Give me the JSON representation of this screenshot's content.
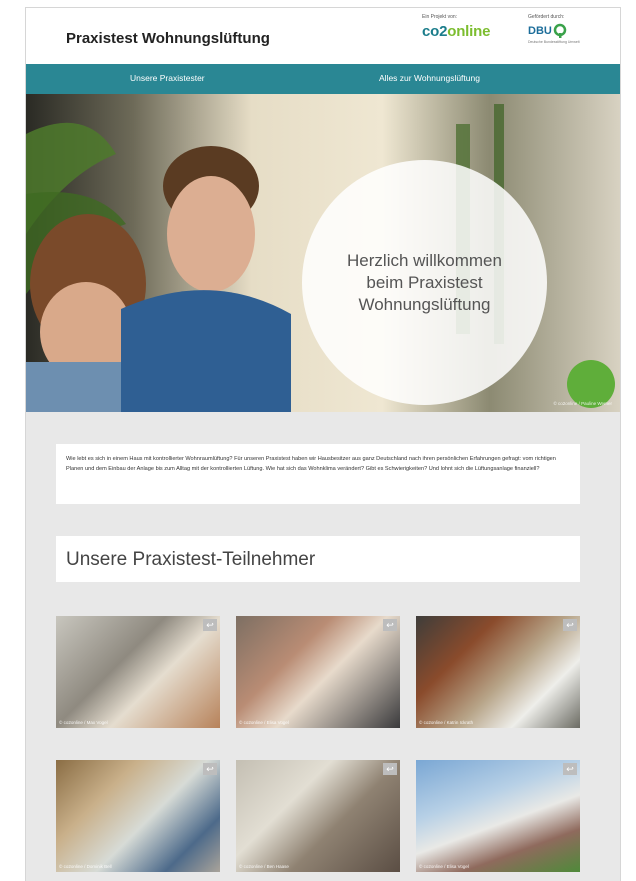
{
  "header": {
    "site_title": "Praxistest Wohnungslüftung",
    "partner_co2": {
      "caption": "Ein Projekt von:",
      "logo_main": "co2",
      "logo_accent": "online"
    },
    "partner_dbu": {
      "caption": "Gefördert durch:",
      "logo": "DBU",
      "sub": "Deutsche Bundesstiftung Umwelt"
    }
  },
  "nav": {
    "items": [
      "Unsere Praxistester",
      "Alles zur Wohnungslüftung"
    ]
  },
  "hero": {
    "heading": "Herzlich willkommen beim Praxistest Wohnungslüftung",
    "credit": "© co2online / Pauline Werner"
  },
  "intro": {
    "text": "Wie lebt es sich in einem Haus mit kontrollierter Wohnraumlüftung? Für unseren Praxistest haben wir Hausbesitzer aus ganz Deutschland nach ihren persönlichen Erfahrungen gefragt: vom richtigen Planen und dem Einbau der Anlage bis zum Alltag mit der kontrollierten Lüftung. Wie hat sich das Wohnklima verändert? Gibt es Schwierigkeiten? Und lohnt sich die Lüftungsanlage finanziell?"
  },
  "section": {
    "title": "Unsere Praxistest-Teilnehmer"
  },
  "participants": [
    {
      "credit": "© co2online / Max Vogel",
      "icon": "flip-icon"
    },
    {
      "credit": "© co2online / Elisa Vogel",
      "icon": "flip-icon"
    },
    {
      "credit": "© co2online / Katrin Ickrath",
      "icon": "flip-icon"
    },
    {
      "credit": "© co2online / Dominik Bell",
      "icon": "flip-icon"
    },
    {
      "credit": "© co2online / Ben Haase",
      "icon": "flip-icon"
    },
    {
      "credit": "© co2online / Elisa Vogel",
      "icon": "flip-icon"
    }
  ],
  "colors": {
    "nav": "#2a8794",
    "background": "#e8e8e8",
    "accent_green": "#7cbd2f",
    "brand_teal": "#1b7d8b"
  }
}
